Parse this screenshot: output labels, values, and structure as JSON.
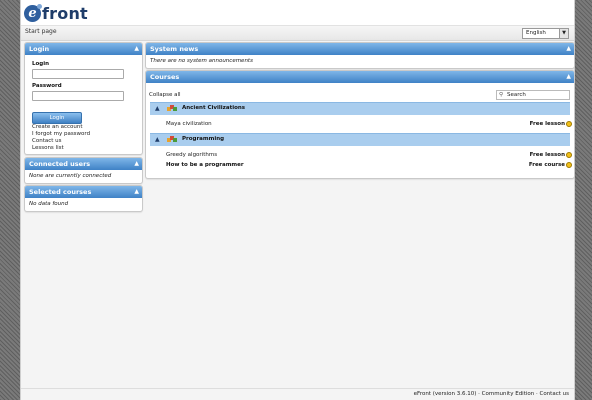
{
  "logo": {
    "text": "front"
  },
  "breadcrumb": {
    "start": "Start page"
  },
  "language": {
    "selected": "English"
  },
  "login": {
    "title": "Login",
    "login_label": "Login",
    "password_label": "Password",
    "button": "Login",
    "links": [
      "Create an account",
      "I forgot my password",
      "Contact us",
      "Lessons list"
    ]
  },
  "connected_users": {
    "title": "Connected users",
    "empty": "None are currently connected"
  },
  "selected_courses": {
    "title": "Selected courses",
    "empty": "No data found"
  },
  "system_news": {
    "title": "System news",
    "empty": "There are no system announcements"
  },
  "courses": {
    "title": "Courses",
    "collapse_all": "Collapse all",
    "search": "Search",
    "groups": [
      {
        "name": "Ancient Civilizations",
        "lessons": [
          {
            "name": "Maya civilization",
            "price": "Free lesson"
          }
        ]
      },
      {
        "name": "Programming",
        "lessons": [
          {
            "name": "Greedy algorithms",
            "price": "Free lesson"
          },
          {
            "name": "How to be a programmer",
            "price": "Free course"
          }
        ]
      }
    ]
  },
  "footer": {
    "text": "eFront (version 3.6.10) · Community Edition · Contact us"
  }
}
